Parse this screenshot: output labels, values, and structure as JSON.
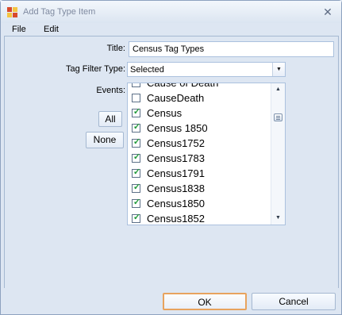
{
  "window": {
    "title": "Add Tag Type Item",
    "close_glyph": "✕"
  },
  "menu": [
    {
      "label": "File"
    },
    {
      "label": "Edit"
    }
  ],
  "form": {
    "title_label": "Title:",
    "title_value": "Census Tag Types",
    "filter_label": "Tag Filter Type:",
    "filter_value": "Selected",
    "events_label": "Events:"
  },
  "buttons": {
    "all": "All",
    "none": "None",
    "ok": "OK",
    "cancel": "Cancel"
  },
  "events": [
    {
      "label": "Cause of Death",
      "checked": false
    },
    {
      "label": "CauseDeath",
      "checked": false
    },
    {
      "label": "Census",
      "checked": true
    },
    {
      "label": "Census  1850",
      "checked": true
    },
    {
      "label": "Census1752",
      "checked": true
    },
    {
      "label": "Census1783",
      "checked": true
    },
    {
      "label": "Census1791",
      "checked": true
    },
    {
      "label": "Census1838",
      "checked": true
    },
    {
      "label": "Census1850",
      "checked": true
    },
    {
      "label": "Census1852",
      "checked": true
    }
  ],
  "icons": {
    "app": "app-icon",
    "dropdown": "chevron-down-icon",
    "check": "checkmark-icon"
  },
  "colors": {
    "accent_border": "#e8a35e",
    "check_green": "#229a3a",
    "background": "#dde6f2"
  }
}
